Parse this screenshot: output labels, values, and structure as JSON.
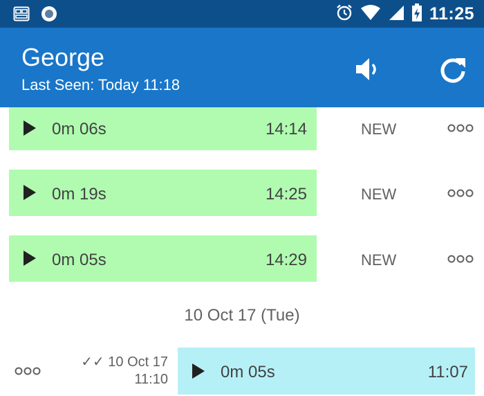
{
  "status_bar": {
    "time": "11:25",
    "icons": [
      "notification-icon",
      "circle-icon",
      "alarm-icon",
      "wifi-icon",
      "signal-icon",
      "battery-charging-icon"
    ]
  },
  "header": {
    "contact_name": "George",
    "last_seen": "Last Seen: Today 11:18",
    "actions": [
      "speaker-icon",
      "refresh-icon"
    ]
  },
  "incoming": [
    {
      "duration": "0m 06s",
      "time": "14:14",
      "badge": "NEW"
    },
    {
      "duration": "0m 19s",
      "time": "14:25",
      "badge": "NEW"
    },
    {
      "duration": "0m 05s",
      "time": "14:29",
      "badge": "NEW"
    }
  ],
  "date_divider": "10 Oct 17 (Tue)",
  "outgoing": {
    "duration": "0m 05s",
    "time": "11:07",
    "ticks": "✓✓",
    "sent_date": "10 Oct 17",
    "sent_time": "11:10"
  },
  "colors": {
    "status_bar": "#0d4f8b",
    "app_bar": "#1976c9",
    "incoming_bubble": "#b0fbb0",
    "outgoing_bubble": "#b6f0f7"
  }
}
